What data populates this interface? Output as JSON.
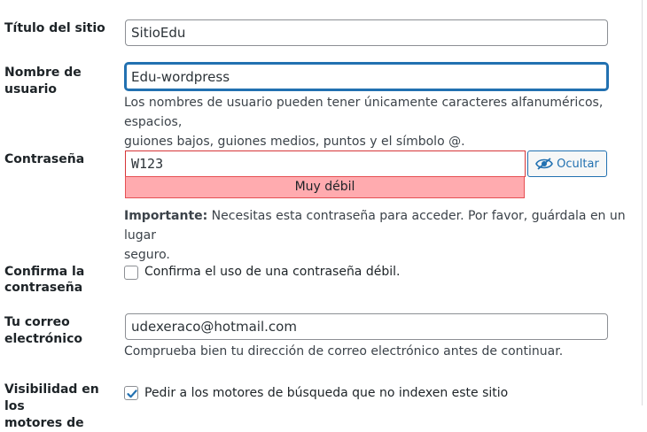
{
  "site_title": {
    "label": "Título del sitio",
    "value": "SitioEdu"
  },
  "username": {
    "label": "Nombre de usuario",
    "value": "Edu-wordpress",
    "description_line1": "Los nombres de usuario pueden tener únicamente caracteres alfanuméricos, espacios,",
    "description_line2": "guiones bajos, guiones medios, puntos y el símbolo @."
  },
  "password": {
    "label": "Contraseña",
    "value": "W123",
    "toggle_label": "Ocultar",
    "toggle_icon": "eye-slash-icon",
    "strength": "Muy débil",
    "important_prefix": "Importante:",
    "important_text_line1": " Necesitas esta contraseña para acceder. Por favor, guárdala en un lugar",
    "important_text_line2": "seguro."
  },
  "confirm_password": {
    "label_line1": "Confirma la",
    "label_line2": "contraseña",
    "checkbox_label": "Confirma el uso de una contraseña débil.",
    "checked": false
  },
  "email": {
    "label_line1": "Tu correo",
    "label_line2": "electrónico",
    "value": "udexeraco@hotmail.com",
    "description": "Comprueba bien tu dirección de correo electrónico antes de continuar."
  },
  "search_visibility": {
    "label_line1": "Visibilidad en los",
    "label_line2": "motores de",
    "checkbox_label": "Pedir a los motores de búsqueda que no indexen este sitio",
    "checked": true
  },
  "colors": {
    "accent": "#2271b1",
    "weak_bg": "#ffabaf",
    "weak_border": "#d63638"
  }
}
